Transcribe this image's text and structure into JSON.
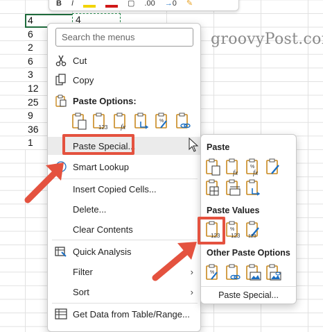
{
  "spreadsheet": {
    "column_values": [
      "4",
      "6",
      "2",
      "6",
      "3",
      "12",
      "25",
      "9",
      "36",
      "1"
    ],
    "copied_cell_value": "4"
  },
  "watermark": "groovyPost.com",
  "mini_toolbar": {
    "bold": "B",
    "italic": "I",
    "decimal": ".00",
    "decimal_arrow": "→",
    "decimal_zero": "0"
  },
  "context_menu": {
    "search_placeholder": "Search the menus",
    "items": {
      "cut": "Cut",
      "copy": "Copy",
      "paste_options": "Paste Options:",
      "paste_special": "Paste Special...",
      "smart_lookup": "Smart Lookup",
      "insert_copied_cells": "Insert Copied Cells...",
      "delete": "Delete...",
      "clear_contents": "Clear Contents",
      "quick_analysis": "Quick Analysis",
      "filter": "Filter",
      "sort": "Sort",
      "get_data": "Get Data from Table/Range..."
    },
    "submenu_chevron": "›"
  },
  "paste_special_submenu": {
    "paste_heading": "Paste",
    "paste_values_heading": "Paste Values",
    "other_heading": "Other Paste Options",
    "footer": "Paste Special...",
    "paste_icons": [
      "paste-icon",
      "paste-formulas-icon",
      "paste-formulas-number-format-icon",
      "keep-source-formatting-icon",
      "no-borders-icon",
      "keep-column-widths-icon",
      "transpose-icon"
    ],
    "values_icons": [
      "values-icon",
      "values-number-format-icon",
      "values-source-formatting-icon"
    ],
    "other_icons": [
      "formatting-icon",
      "paste-link-icon",
      "picture-icon",
      "linked-picture-icon"
    ]
  },
  "colors": {
    "highlight_annotation": "#e4523f",
    "cell_border": "#1e6b3c",
    "clipboard_amber": "#c8891e",
    "accent_blue": "#1a6fc4"
  }
}
